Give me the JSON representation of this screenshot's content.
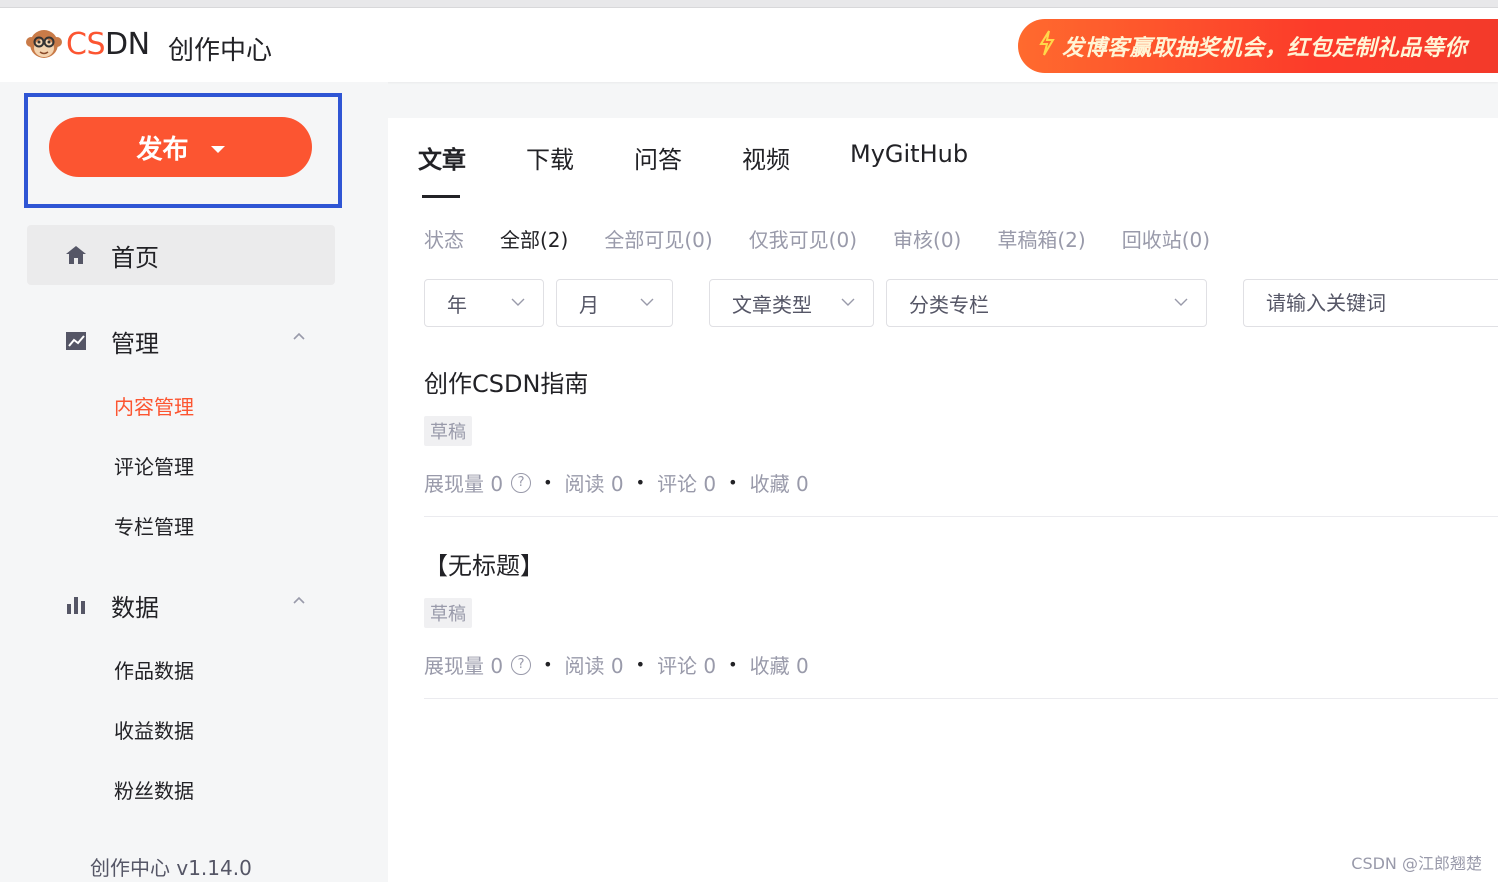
{
  "header": {
    "logo_csdn_left": "CS",
    "logo_csdn_right": "DN",
    "title": "创作中心",
    "promo_text": "发博客赢取抽奖机会，红包定制礼品等你",
    "promo_icon": "lightning-icon"
  },
  "sidebar": {
    "publish_label": "发布",
    "home_label": "首页",
    "groups": [
      {
        "label": "管理",
        "icon": "chart-line-icon",
        "items": [
          "内容管理",
          "评论管理",
          "专栏管理"
        ],
        "active": "内容管理"
      },
      {
        "label": "数据",
        "icon": "bar-chart-icon",
        "items": [
          "作品数据",
          "收益数据",
          "粉丝数据"
        ]
      }
    ],
    "version": "创作中心 v1.14.0"
  },
  "main": {
    "tabs": [
      "文章",
      "下载",
      "问答",
      "视频",
      "MyGitHub"
    ],
    "active_tab": "文章",
    "status": {
      "label": "状态",
      "items": [
        "全部(2)",
        "全部可见(0)",
        "仅我可见(0)",
        "审核(0)",
        "草稿箱(2)",
        "回收站(0)"
      ],
      "active": "全部(2)"
    },
    "filters": {
      "year": "年",
      "month": "月",
      "article_type": "文章类型",
      "column": "分类专栏",
      "search_placeholder": "请输入关键词"
    },
    "articles": [
      {
        "title": "创作CSDN指南",
        "tag": "草稿",
        "impressions": "展现量 0",
        "reads": "阅读 0",
        "comments": "评论 0",
        "favorites": "收藏 0"
      },
      {
        "title": "【无标题】",
        "tag": "草稿",
        "impressions": "展现量 0",
        "reads": "阅读 0",
        "comments": "评论 0",
        "favorites": "收藏 0"
      }
    ]
  },
  "watermark": "CSDN @江郎翘楚",
  "colors": {
    "accent": "#fc5531",
    "highlight_border": "#2f55d4"
  }
}
